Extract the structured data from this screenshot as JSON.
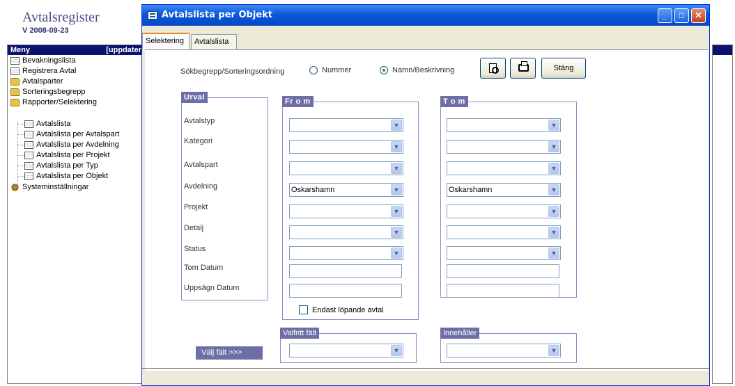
{
  "app": {
    "title": "Avtalsregister",
    "version": "V 2008-09-23",
    "menu_header": "Meny",
    "menu_header_right": "[uppdater"
  },
  "tree": [
    {
      "label": "Bevakningslista",
      "icon": "document-icon"
    },
    {
      "label": "Registrera Avtal",
      "icon": "list-icon"
    },
    {
      "label": "Avtalsparter",
      "icon": "folder-icon"
    },
    {
      "label": "Sorteringsbegrepp",
      "icon": "folder-icon"
    },
    {
      "label": "Rapporter/Selektering",
      "icon": "folder-open-icon"
    },
    {
      "label": "Avtalslista",
      "icon": "document-icon"
    },
    {
      "label": "Avtalslista per Avtalspart",
      "icon": "document-icon"
    },
    {
      "label": "Avtalslista per Avdelning",
      "icon": "document-icon"
    },
    {
      "label": "Avtalslista per Projekt",
      "icon": "document-icon"
    },
    {
      "label": "Avtalslista per Typ",
      "icon": "document-icon"
    },
    {
      "label": "Avtalslista per Objekt",
      "icon": "document-icon"
    },
    {
      "label": "Systeminställningar",
      "icon": "gear-icon"
    }
  ],
  "dialog": {
    "title": "Avtalslista per Objekt",
    "tabs": [
      "Selektering",
      "Avtalslista"
    ],
    "active_tab": "Selektering"
  },
  "toolbar": {
    "sort_label": "Sökbegrepp/Sorteringsordning",
    "radio_number": "Nummer",
    "radio_name": "Namn/Beskrivning",
    "selected": "Namn/Beskrivning",
    "close_label": "Stäng"
  },
  "groups": {
    "urval": "Urval",
    "from": "Fr o m",
    "to": "T o m",
    "valfritt": "Valfritt fält",
    "innehaller": "Innehåller"
  },
  "fields": [
    {
      "label": "Avtalstyp",
      "from": "",
      "to": ""
    },
    {
      "label": "Kategori",
      "from": "",
      "to": ""
    },
    {
      "label": "Avtalspart",
      "from": "",
      "to": ""
    },
    {
      "label": "Avdelning",
      "from": "Oskarshamn",
      "to": "Oskarshamn"
    },
    {
      "label": "Projekt",
      "from": "",
      "to": ""
    },
    {
      "label": "Detalj",
      "from": "",
      "to": ""
    },
    {
      "label": "Status",
      "from": "",
      "to": ""
    },
    {
      "label": "Tom Datum",
      "from": "",
      "to": ""
    },
    {
      "label": "Uppsägn Datum",
      "from": "",
      "to": ""
    }
  ],
  "checkbox_label": "Endast löpande avtal",
  "choose_field_label": "Välj fält >>>",
  "colors": {
    "group_header": "#6e6ea6",
    "titlebar": "#0a58d8",
    "menu_header": "#0b1270"
  }
}
